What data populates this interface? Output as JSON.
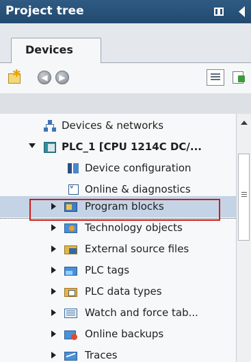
{
  "panel": {
    "title": "Project tree"
  },
  "tabs": [
    {
      "label": "Devices",
      "active": true
    }
  ],
  "toolbar": {
    "icons": [
      "new-item-icon",
      "back-icon",
      "forward-icon",
      "detail-view-icon",
      "export-icon"
    ]
  },
  "tree": {
    "items": [
      {
        "label": "Devices & networks",
        "icon": "network-icon",
        "expander": "none",
        "level": 1
      },
      {
        "label": "PLC_1 [CPU 1214C DC/...",
        "icon": "plc-icon",
        "expander": "expanded",
        "level": 0,
        "bold": true
      },
      {
        "label": "Device configuration",
        "icon": "device-config-icon",
        "expander": "none",
        "level": 2
      },
      {
        "label": "Online & diagnostics",
        "icon": "online-diagnostics-icon",
        "expander": "none",
        "level": 2
      },
      {
        "label": "Program blocks",
        "icon": "program-blocks-icon",
        "expander": "collapsed",
        "level": 1,
        "selected": true,
        "highlighted": true
      },
      {
        "label": "Technology objects",
        "icon": "technology-objects-icon",
        "expander": "collapsed",
        "level": 1
      },
      {
        "label": "External source files",
        "icon": "external-source-icon",
        "expander": "collapsed",
        "level": 1
      },
      {
        "label": "PLC tags",
        "icon": "plc-tags-icon",
        "expander": "collapsed",
        "level": 1
      },
      {
        "label": "PLC data types",
        "icon": "plc-data-types-icon",
        "expander": "collapsed",
        "level": 1
      },
      {
        "label": "Watch and force tab...",
        "icon": "watch-force-icon",
        "expander": "collapsed",
        "level": 1
      },
      {
        "label": "Online backups",
        "icon": "online-backups-icon",
        "expander": "collapsed",
        "level": 1
      },
      {
        "label": "Traces",
        "icon": "traces-icon",
        "expander": "collapsed",
        "level": 1
      }
    ]
  },
  "colors": {
    "titlebar": "#2a527a",
    "selection": "#c4d4e6",
    "highlight_border": "#d21a1a"
  }
}
